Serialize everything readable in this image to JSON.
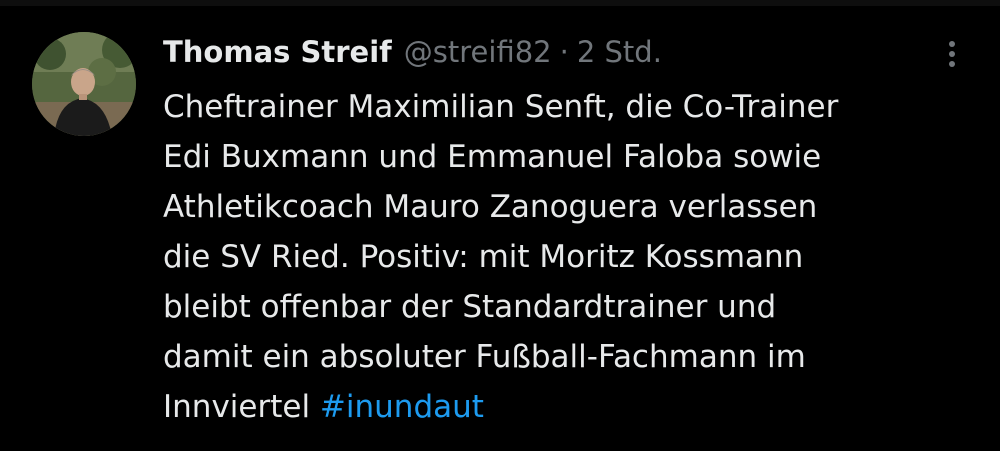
{
  "tweet": {
    "author": {
      "display_name": "Thomas Streif",
      "handle": "@streifi82",
      "separator": "·",
      "time": "2 Std.",
      "avatar_icon": "user-avatar-photo"
    },
    "more_icon": "more-vertical-icon",
    "text_lines": [
      "Cheftrainer Maximilian Senft, die Co-Trainer",
      "Edi Buxmann und Emmanuel Faloba sowie",
      "Athletikcoach Mauro Zanoguera verlassen",
      "die SV Ried. Positiv: mit Moritz Kossmann",
      "bleibt offenbar der Standardtrainer und",
      "damit ein absoluter Fußball-Fachmann im"
    ],
    "last_line_text": "Innviertel ",
    "hashtag": "#inundaut"
  },
  "colors": {
    "background": "#000000",
    "text_primary": "#e7e9ea",
    "text_secondary": "#71767b",
    "link": "#1d9bf0"
  }
}
